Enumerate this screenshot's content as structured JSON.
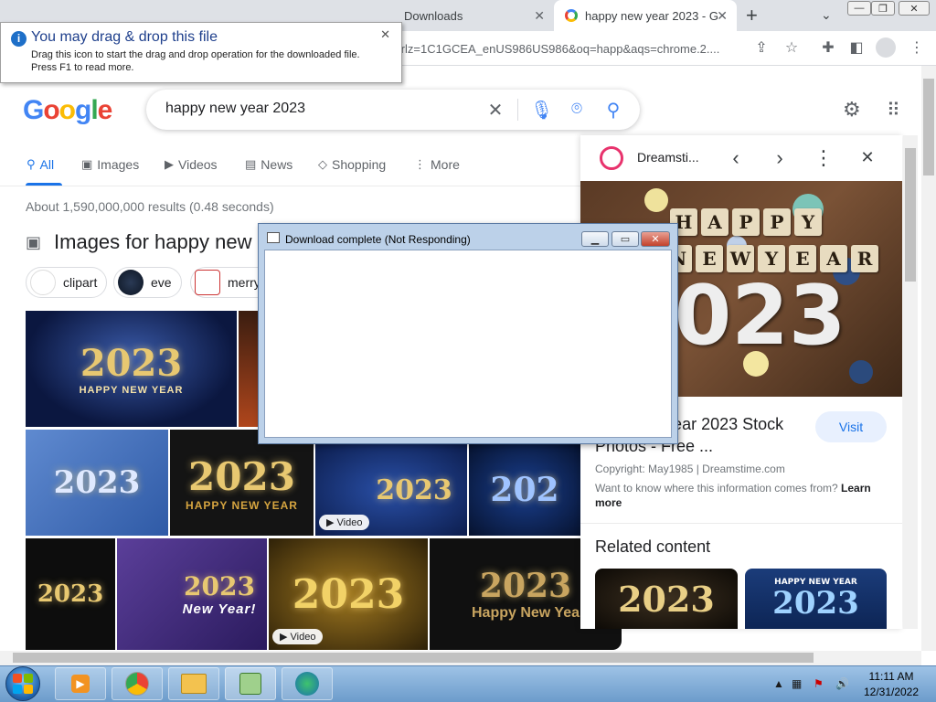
{
  "browser": {
    "tabs": [
      {
        "label": "Downloads"
      },
      {
        "label": "happy new year 2023 - G"
      }
    ],
    "omnibox_text": "&rlz=1C1GCEA_enUS986US986&oq=happ&aqs=chrome.2....",
    "new_tab_label": "+"
  },
  "balloon": {
    "title": "You may drag & drop this file",
    "line1": "Drag this icon to start the drag and drop operation for the downloaded file.",
    "line2": "Press F1 to read more."
  },
  "google": {
    "logo_text": "Google",
    "query": "happy new year 2023",
    "nav": [
      "All",
      "Images",
      "Videos",
      "News",
      "Shopping",
      "More"
    ],
    "result_stats": "About 1,590,000,000 results (0.48 seconds)",
    "images_heading": "Images for happy new",
    "chips": [
      "clipart",
      "eve",
      "merry"
    ],
    "grid_images": [
      {
        "year": "2023",
        "caption": "HAPPY NEW YEAR"
      },
      {
        "year": "",
        "caption": ""
      },
      {
        "year": "2023",
        "caption": ""
      },
      {
        "year": "2023",
        "caption": "HAPPY NEW YEAR"
      },
      {
        "year": "2023",
        "caption": ""
      },
      {
        "year": "202",
        "caption": ""
      },
      {
        "year": "2023",
        "caption": ""
      },
      {
        "year": "2023",
        "caption": "New Year!"
      },
      {
        "year": "2023",
        "caption": ""
      },
      {
        "year": "2023",
        "caption": "Happy New Yea"
      }
    ],
    "video_badge": "Video"
  },
  "side_panel": {
    "source": "Dreamsti...",
    "hero_letters_row1": [
      "H",
      "A",
      "P",
      "P",
      "Y"
    ],
    "hero_letters_row2": [
      "N",
      "E",
      "W",
      "Y",
      "E",
      "A",
      "R"
    ],
    "hero_year": "2023",
    "title": "ppy New Year 2023 Stock Photos - Free ...",
    "visit_label": "Visit",
    "copyright": "Copyright: May1985 | Dreamstime.com",
    "question": "Want to know where this information comes from?",
    "learn_more": "Learn more",
    "related_title": "Related content",
    "related_images": [
      {
        "year": "2023"
      },
      {
        "caption": "HAPPY NEW YEAR",
        "year": "2023"
      }
    ]
  },
  "dialog": {
    "title": "Download complete (Not Responding)"
  },
  "taskbar": {
    "time": "11:11 AM",
    "date": "12/31/2022"
  },
  "colors": {
    "google_blue": "#1a73e8",
    "taskbar": "#6c9ccb",
    "dialog_frame": "#bcd1e9"
  }
}
